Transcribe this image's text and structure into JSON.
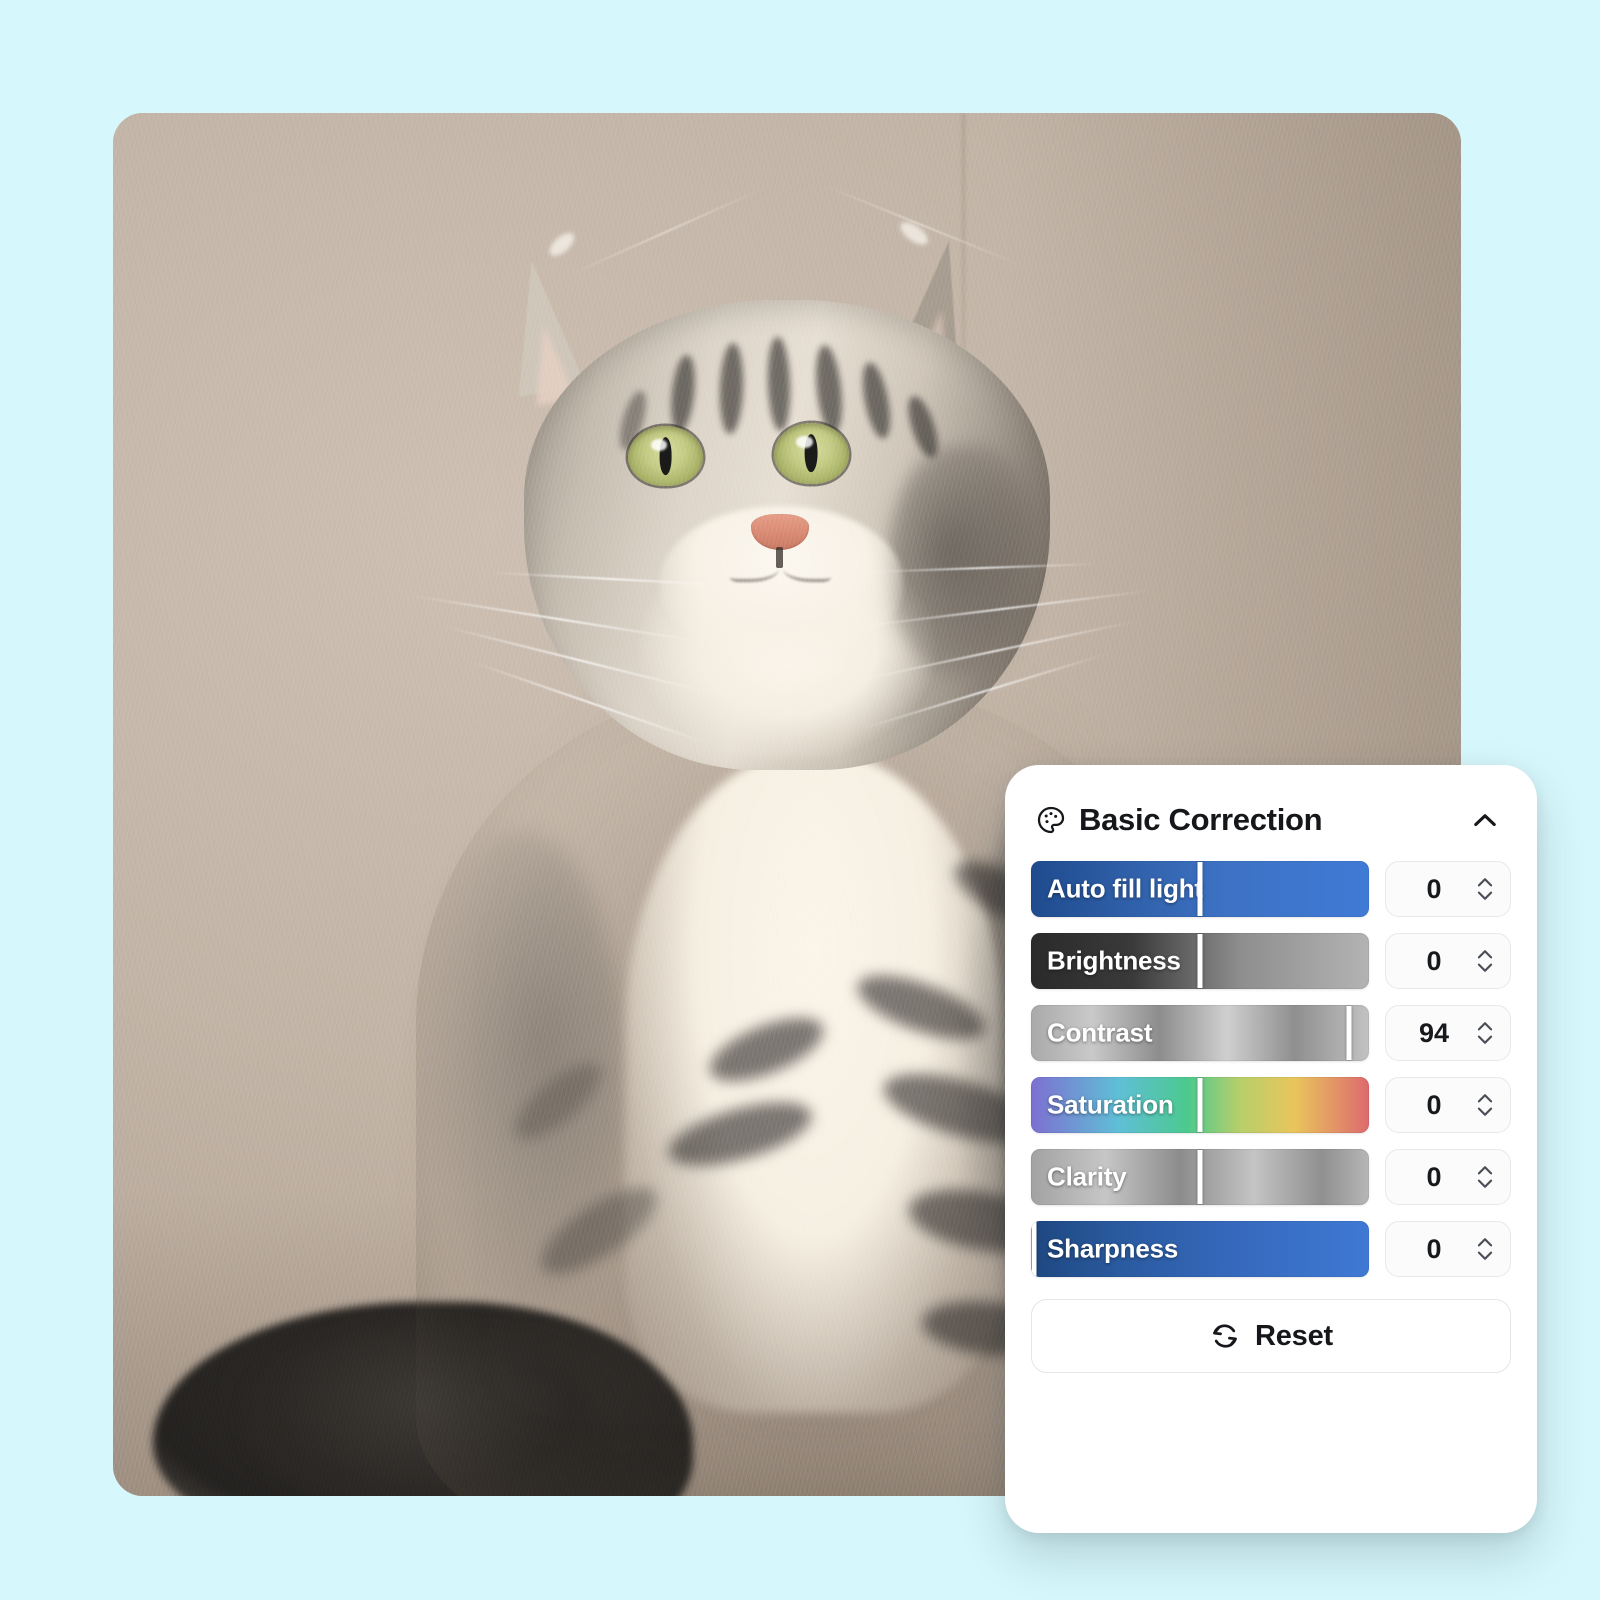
{
  "background_color": "#d6f7fb",
  "photo": {
    "alt_subject": "tabby cat portrait",
    "wall_color": "#bfb1a4",
    "corner_radius": "30px"
  },
  "panel": {
    "title": "Basic Correction",
    "title_icon": "palette-icon",
    "collapse_icon": "chevron-up-icon",
    "background": "#ffffff",
    "sliders": [
      {
        "label": "Auto fill light",
        "value": "0",
        "thumb_percent": 50,
        "gradient_class": "g-autofill",
        "accent": "#3f7ad6"
      },
      {
        "label": "Brightness",
        "value": "0",
        "thumb_percent": 50,
        "gradient_class": "g-brightness",
        "accent": "#8e8e8e"
      },
      {
        "label": "Contrast",
        "value": "94",
        "thumb_percent": 94,
        "gradient_class": "g-contrast",
        "accent": "#b0b0b0"
      },
      {
        "label": "Saturation",
        "value": "0",
        "thumb_percent": 50,
        "gradient_class": "g-saturation",
        "accent": "#4cc98f"
      },
      {
        "label": "Clarity",
        "value": "0",
        "thumb_percent": 50,
        "gradient_class": "g-clarity",
        "accent": "#a8a8a8"
      },
      {
        "label": "Sharpness",
        "value": "0",
        "thumb_percent": 1,
        "gradient_class": "g-sharpness",
        "accent": "#3568bb"
      }
    ],
    "reset": {
      "label": "Reset",
      "icon": "refresh-icon"
    },
    "stepper_icons": {
      "up": "chevron-up-small-icon",
      "down": "chevron-down-small-icon"
    }
  }
}
